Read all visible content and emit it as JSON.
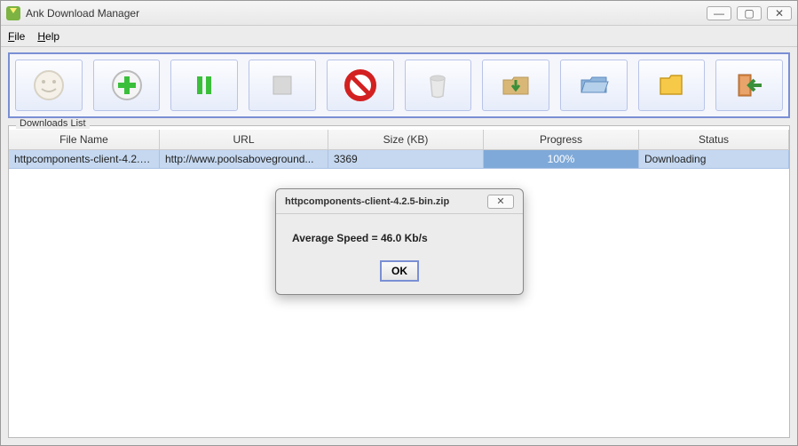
{
  "window": {
    "title": "Ank Download Manager"
  },
  "menu": {
    "file": "File",
    "help": "Help"
  },
  "group": {
    "label": "Downloads List"
  },
  "columns": {
    "file": "File Name",
    "url": "URL",
    "size": "Size (KB)",
    "progress": "Progress",
    "status": "Status"
  },
  "rows": [
    {
      "file": "httpcomponents-client-4.2.5-...",
      "url": "http://www.poolsaboveground...",
      "size": "3369",
      "progress": "100%",
      "status": "Downloading"
    }
  ],
  "dialog": {
    "title": "httpcomponents-client-4.2.5-bin.zip",
    "text": "Average Speed = 46.0 Kb/s",
    "ok": "OK"
  }
}
